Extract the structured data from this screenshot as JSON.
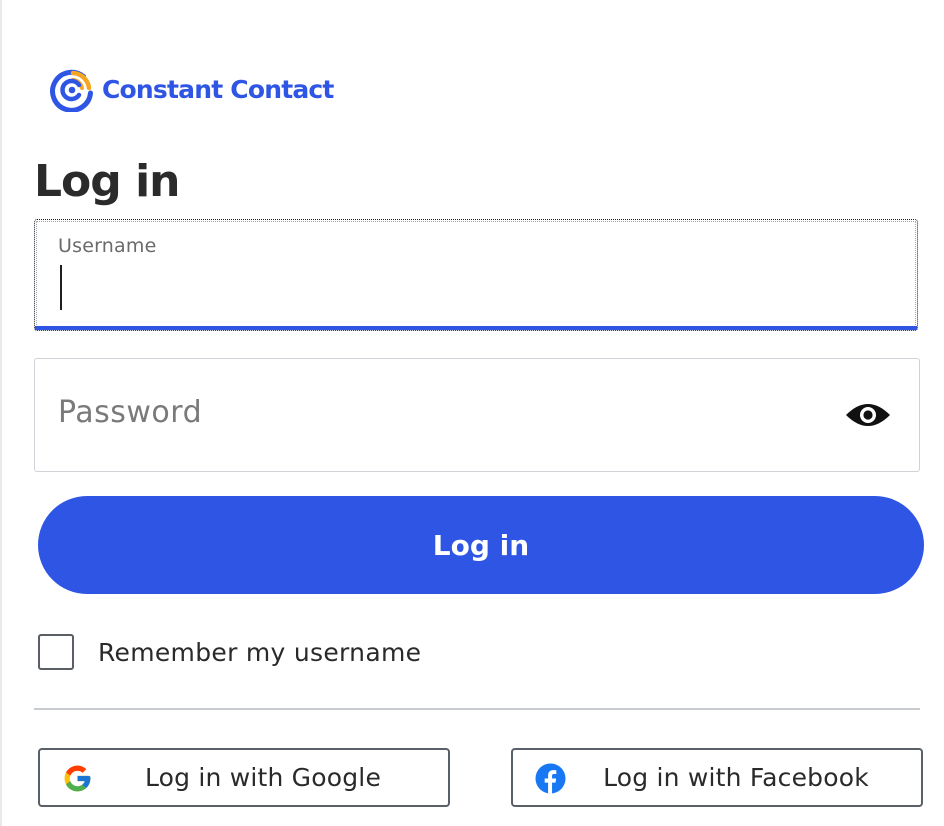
{
  "brand": {
    "name": "Constant Contact",
    "color": "#2f55e4",
    "accent_orange": "#f5a623",
    "logo_icon": "constant-contact-logo-icon"
  },
  "page": {
    "title": "Log in"
  },
  "form": {
    "username": {
      "label": "Username",
      "value": ""
    },
    "password": {
      "placeholder": "Password",
      "value": "",
      "toggle_icon": "eye-icon"
    },
    "submit_label": "Log in",
    "remember": {
      "label": "Remember my username",
      "checked": false
    }
  },
  "social": {
    "google": {
      "label": "Log in with Google",
      "icon": "google-icon"
    },
    "facebook": {
      "label": "Log in with Facebook",
      "icon": "facebook-icon"
    }
  },
  "colors": {
    "primary_button": "#2f55e4",
    "facebook_blue": "#1877f2"
  }
}
